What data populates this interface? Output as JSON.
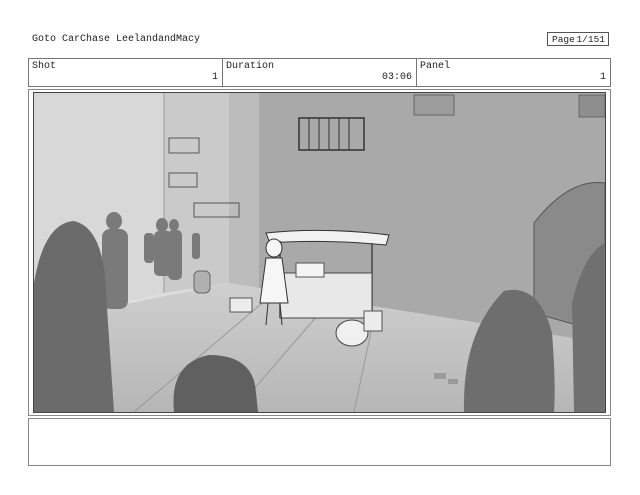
{
  "header": {
    "title": "Goto CarChase LeelandandMacy",
    "page_label": "Page",
    "page_value": "1/151"
  },
  "info": {
    "shot_label": "Shot",
    "shot_value": "1",
    "duration_label": "Duration",
    "duration_value": "03:06",
    "panel_label": "Panel",
    "panel_value": "1"
  },
  "notes": {
    "text": ""
  }
}
